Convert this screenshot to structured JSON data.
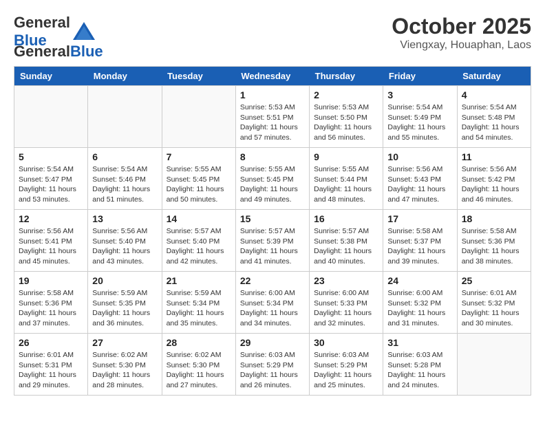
{
  "header": {
    "logo_general": "General",
    "logo_blue": "Blue",
    "title": "October 2025",
    "subtitle": "Viengxay, Houaphan, Laos"
  },
  "weekdays": [
    "Sunday",
    "Monday",
    "Tuesday",
    "Wednesday",
    "Thursday",
    "Friday",
    "Saturday"
  ],
  "weeks": [
    [
      {
        "day": "",
        "info": ""
      },
      {
        "day": "",
        "info": ""
      },
      {
        "day": "",
        "info": ""
      },
      {
        "day": "1",
        "info": "Sunrise: 5:53 AM\nSunset: 5:51 PM\nDaylight: 11 hours and 57 minutes."
      },
      {
        "day": "2",
        "info": "Sunrise: 5:53 AM\nSunset: 5:50 PM\nDaylight: 11 hours and 56 minutes."
      },
      {
        "day": "3",
        "info": "Sunrise: 5:54 AM\nSunset: 5:49 PM\nDaylight: 11 hours and 55 minutes."
      },
      {
        "day": "4",
        "info": "Sunrise: 5:54 AM\nSunset: 5:48 PM\nDaylight: 11 hours and 54 minutes."
      }
    ],
    [
      {
        "day": "5",
        "info": "Sunrise: 5:54 AM\nSunset: 5:47 PM\nDaylight: 11 hours and 53 minutes."
      },
      {
        "day": "6",
        "info": "Sunrise: 5:54 AM\nSunset: 5:46 PM\nDaylight: 11 hours and 51 minutes."
      },
      {
        "day": "7",
        "info": "Sunrise: 5:55 AM\nSunset: 5:45 PM\nDaylight: 11 hours and 50 minutes."
      },
      {
        "day": "8",
        "info": "Sunrise: 5:55 AM\nSunset: 5:45 PM\nDaylight: 11 hours and 49 minutes."
      },
      {
        "day": "9",
        "info": "Sunrise: 5:55 AM\nSunset: 5:44 PM\nDaylight: 11 hours and 48 minutes."
      },
      {
        "day": "10",
        "info": "Sunrise: 5:56 AM\nSunset: 5:43 PM\nDaylight: 11 hours and 47 minutes."
      },
      {
        "day": "11",
        "info": "Sunrise: 5:56 AM\nSunset: 5:42 PM\nDaylight: 11 hours and 46 minutes."
      }
    ],
    [
      {
        "day": "12",
        "info": "Sunrise: 5:56 AM\nSunset: 5:41 PM\nDaylight: 11 hours and 45 minutes."
      },
      {
        "day": "13",
        "info": "Sunrise: 5:56 AM\nSunset: 5:40 PM\nDaylight: 11 hours and 43 minutes."
      },
      {
        "day": "14",
        "info": "Sunrise: 5:57 AM\nSunset: 5:40 PM\nDaylight: 11 hours and 42 minutes."
      },
      {
        "day": "15",
        "info": "Sunrise: 5:57 AM\nSunset: 5:39 PM\nDaylight: 11 hours and 41 minutes."
      },
      {
        "day": "16",
        "info": "Sunrise: 5:57 AM\nSunset: 5:38 PM\nDaylight: 11 hours and 40 minutes."
      },
      {
        "day": "17",
        "info": "Sunrise: 5:58 AM\nSunset: 5:37 PM\nDaylight: 11 hours and 39 minutes."
      },
      {
        "day": "18",
        "info": "Sunrise: 5:58 AM\nSunset: 5:36 PM\nDaylight: 11 hours and 38 minutes."
      }
    ],
    [
      {
        "day": "19",
        "info": "Sunrise: 5:58 AM\nSunset: 5:36 PM\nDaylight: 11 hours and 37 minutes."
      },
      {
        "day": "20",
        "info": "Sunrise: 5:59 AM\nSunset: 5:35 PM\nDaylight: 11 hours and 36 minutes."
      },
      {
        "day": "21",
        "info": "Sunrise: 5:59 AM\nSunset: 5:34 PM\nDaylight: 11 hours and 35 minutes."
      },
      {
        "day": "22",
        "info": "Sunrise: 6:00 AM\nSunset: 5:34 PM\nDaylight: 11 hours and 34 minutes."
      },
      {
        "day": "23",
        "info": "Sunrise: 6:00 AM\nSunset: 5:33 PM\nDaylight: 11 hours and 32 minutes."
      },
      {
        "day": "24",
        "info": "Sunrise: 6:00 AM\nSunset: 5:32 PM\nDaylight: 11 hours and 31 minutes."
      },
      {
        "day": "25",
        "info": "Sunrise: 6:01 AM\nSunset: 5:32 PM\nDaylight: 11 hours and 30 minutes."
      }
    ],
    [
      {
        "day": "26",
        "info": "Sunrise: 6:01 AM\nSunset: 5:31 PM\nDaylight: 11 hours and 29 minutes."
      },
      {
        "day": "27",
        "info": "Sunrise: 6:02 AM\nSunset: 5:30 PM\nDaylight: 11 hours and 28 minutes."
      },
      {
        "day": "28",
        "info": "Sunrise: 6:02 AM\nSunset: 5:30 PM\nDaylight: 11 hours and 27 minutes."
      },
      {
        "day": "29",
        "info": "Sunrise: 6:03 AM\nSunset: 5:29 PM\nDaylight: 11 hours and 26 minutes."
      },
      {
        "day": "30",
        "info": "Sunrise: 6:03 AM\nSunset: 5:29 PM\nDaylight: 11 hours and 25 minutes."
      },
      {
        "day": "31",
        "info": "Sunrise: 6:03 AM\nSunset: 5:28 PM\nDaylight: 11 hours and 24 minutes."
      },
      {
        "day": "",
        "info": ""
      }
    ]
  ]
}
